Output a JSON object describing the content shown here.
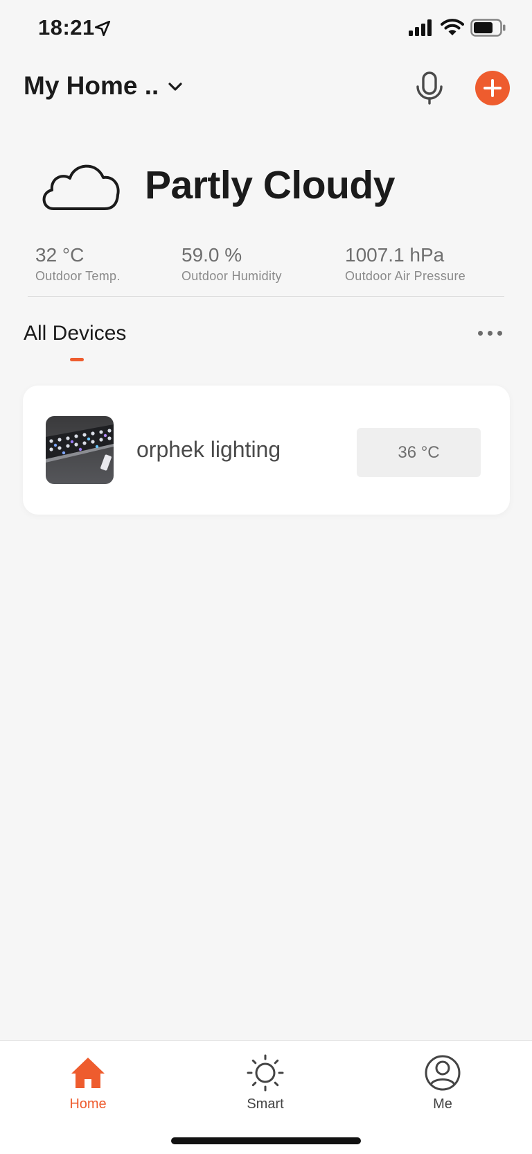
{
  "status_bar": {
    "time": "18:21"
  },
  "header": {
    "home_name": "My Home ..",
    "icons": [
      "chevron-down-icon",
      "microphone-icon",
      "plus-icon"
    ]
  },
  "weather": {
    "condition": "Partly Cloudy",
    "icon": "cloud-icon",
    "metrics": [
      {
        "value": "32 °C",
        "label": "Outdoor Temp."
      },
      {
        "value": "59.0 %",
        "label": "Outdoor Humidity"
      },
      {
        "value": "1007.1 hPa",
        "label": "Outdoor Air Pressure"
      }
    ]
  },
  "devices": {
    "section_title": "All Devices",
    "items": [
      {
        "name": "orphek lighting",
        "reading": "36 °C"
      }
    ]
  },
  "tabbar": {
    "tabs": [
      {
        "label": "Home",
        "icon": "house-icon",
        "active": true
      },
      {
        "label": "Smart",
        "icon": "sun-icon",
        "active": false
      },
      {
        "label": "Me",
        "icon": "user-circle-icon",
        "active": false
      }
    ]
  },
  "colors": {
    "accent": "#ee5c2e",
    "background": "#f6f6f6",
    "card": "#ffffff"
  }
}
